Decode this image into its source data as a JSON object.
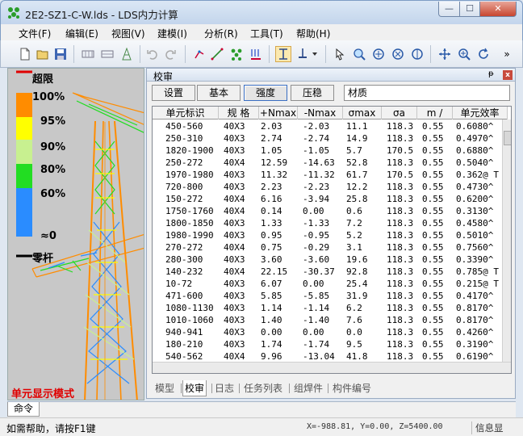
{
  "window": {
    "title": "2E2-SZ1-C-W.lds - LDS内力计算",
    "min": "—",
    "max": "☐",
    "close": "✕"
  },
  "menu": [
    {
      "label": "文件(F)"
    },
    {
      "label": "编辑(E)"
    },
    {
      "label": "视图(V)"
    },
    {
      "label": "建模(I)"
    },
    {
      "label": "分析(R)"
    },
    {
      "label": "工具(T)"
    },
    {
      "label": "帮助(H)"
    }
  ],
  "toolbar": {
    "icons": [
      "new-file-icon",
      "open-folder-icon",
      "save-icon",
      "grid-icon",
      "grid2-icon",
      "tower-icon",
      "undo-icon",
      "redo-icon",
      "node-icon",
      "rod-icon",
      "mesh-icon",
      "load-icon",
      "section-icon",
      "support-icon",
      "cursor-icon",
      "zoom-window-icon",
      "rotate-icon",
      "rotate2-icon",
      "rotate3-icon",
      "pan-icon",
      "zoom-in-icon",
      "refresh-icon",
      "overflow-icon"
    ],
    "overflow_label": "»"
  },
  "legend": {
    "over_limit": "超限",
    "levels": [
      "100%",
      "95%",
      "90%",
      "80%",
      "60%",
      "≈0"
    ],
    "zero_rod": "零杆",
    "colors": [
      "#ff8c00",
      "#ffff00",
      "#c8f090",
      "#22dd22",
      "#2a8cff"
    ]
  },
  "mode_label": "单元显示模式",
  "panel": {
    "title": "校审",
    "pin": "ᵽ",
    "close": "x",
    "buttons": [
      {
        "label": "设置"
      },
      {
        "label": "基本"
      },
      {
        "label": "强度"
      },
      {
        "label": "压稳"
      }
    ],
    "material": "材质"
  },
  "table": {
    "headers": [
      "单元标识",
      "规 格",
      "+Nmax",
      "-Nmax",
      "σmax",
      "σa",
      "m /",
      "单元效率"
    ],
    "rows": [
      [
        "450-560",
        "40X3",
        "2.03",
        "-2.03",
        "11.1",
        "118.3",
        "0.55",
        "0.6080^"
      ],
      [
        "250-310",
        "40X3",
        "2.74",
        "-2.74",
        "14.9",
        "118.3",
        "0.55",
        "0.4970^"
      ],
      [
        "1820-1900",
        "40X3",
        "1.05",
        "-1.05",
        "5.7",
        "170.5",
        "0.55",
        "0.6880^"
      ],
      [
        "250-272",
        "40X4",
        "12.59",
        "-14.63",
        "52.8",
        "118.3",
        "0.55",
        "0.5040^"
      ],
      [
        "1970-1980",
        "40X3",
        "11.32",
        "-11.32",
        "61.7",
        "170.5",
        "0.55",
        "0.362@ T"
      ],
      [
        "720-800",
        "40X3",
        "2.23",
        "-2.23",
        "12.2",
        "118.3",
        "0.55",
        "0.4730^"
      ],
      [
        "150-272",
        "40X4",
        "6.16",
        "-3.94",
        "25.8",
        "118.3",
        "0.55",
        "0.6200^"
      ],
      [
        "1750-1760",
        "40X4",
        "0.14",
        "0.00",
        "0.6",
        "118.3",
        "0.55",
        "0.3130^"
      ],
      [
        "1800-1850",
        "40X3",
        "1.33",
        "-1.33",
        "7.2",
        "118.3",
        "0.55",
        "0.4580^"
      ],
      [
        "1980-1990",
        "40X3",
        "0.95",
        "-0.95",
        "5.2",
        "118.3",
        "0.55",
        "0.5010^"
      ],
      [
        "270-272",
        "40X4",
        "0.75",
        "-0.29",
        "3.1",
        "118.3",
        "0.55",
        "0.7560^"
      ],
      [
        "280-300",
        "40X3",
        "3.60",
        "-3.60",
        "19.6",
        "118.3",
        "0.55",
        "0.3390^"
      ],
      [
        "140-232",
        "40X4",
        "22.15",
        "-30.37",
        "92.8",
        "118.3",
        "0.55",
        "0.785@ T"
      ],
      [
        "10-72",
        "40X3",
        "6.07",
        "0.00",
        "25.4",
        "118.3",
        "0.55",
        "0.215@ T"
      ],
      [
        "471-600",
        "40X3",
        "5.85",
        "-5.85",
        "31.9",
        "118.3",
        "0.55",
        "0.4170^"
      ],
      [
        "1080-1130",
        "40X3",
        "1.14",
        "-1.14",
        "6.2",
        "118.3",
        "0.55",
        "0.8170^"
      ],
      [
        "1010-1060",
        "40X3",
        "1.40",
        "-1.40",
        "7.6",
        "118.3",
        "0.55",
        "0.8170^"
      ],
      [
        "940-941",
        "40X3",
        "0.00",
        "0.00",
        "0.0",
        "118.3",
        "0.55",
        "0.4260^"
      ],
      [
        "180-210",
        "40X3",
        "1.74",
        "-1.74",
        "9.5",
        "118.3",
        "0.55",
        "0.3190^"
      ],
      [
        "540-562",
        "40X4",
        "9.96",
        "-13.04",
        "41.8",
        "118.3",
        "0.55",
        "0.6190^"
      ]
    ]
  },
  "bottom_tabs": [
    {
      "label": "模型"
    },
    {
      "label": "校审"
    },
    {
      "label": "日志"
    },
    {
      "label": "任务列表"
    },
    {
      "label": "组焊件"
    },
    {
      "label": "构件编号"
    }
  ],
  "command_tab": "命令",
  "status": {
    "help": "如需帮助，请按F1键",
    "coords": "X=-988.81, Y=0.00, Z=5400.00",
    "info": "信息显"
  }
}
